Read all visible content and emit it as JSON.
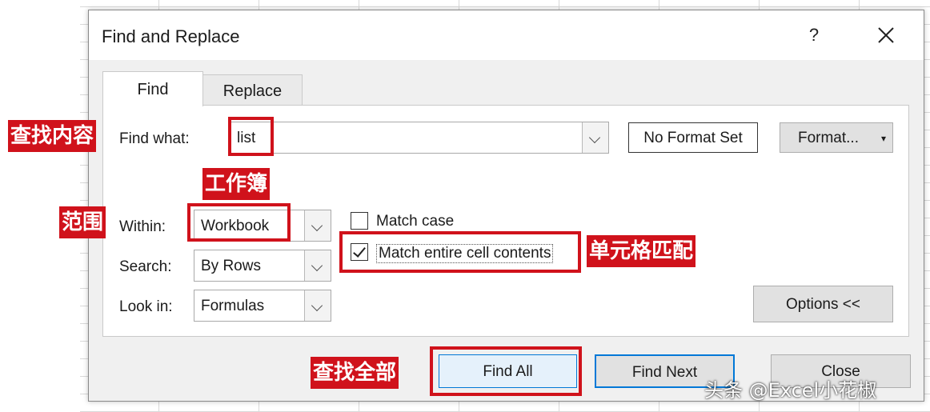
{
  "dialog": {
    "title": "Find and Replace",
    "help_label": "?"
  },
  "tabs": [
    {
      "label": "Find",
      "selected": true
    },
    {
      "label": "Replace",
      "selected": false
    }
  ],
  "find": {
    "find_what_label": "Find what:",
    "find_what_value": "list",
    "format_status": "No Format Set",
    "format_button": "Format...",
    "within_label": "Within:",
    "within_value": "Workbook",
    "search_label": "Search:",
    "search_value": "By Rows",
    "look_in_label": "Look in:",
    "look_in_value": "Formulas",
    "match_case_label": "Match case",
    "match_case_checked": false,
    "match_entire_label": "Match entire cell contents",
    "match_entire_checked": true,
    "options_button": "Options <<"
  },
  "buttons": {
    "find_all": "Find All",
    "find_next": "Find Next",
    "close": "Close"
  },
  "annotations": {
    "find_content": "查找内容",
    "workbook": "工作簿",
    "scope": "范围",
    "cell_match": "单元格匹配",
    "find_all": "查找全部"
  },
  "watermark": "头条 @Excel小花椒",
  "colors": {
    "annotation_red": "#d0121b",
    "dialog_bg": "#f0f0f0",
    "find_all_bg": "#e5f1fb",
    "find_next_border": "#0078d7"
  }
}
